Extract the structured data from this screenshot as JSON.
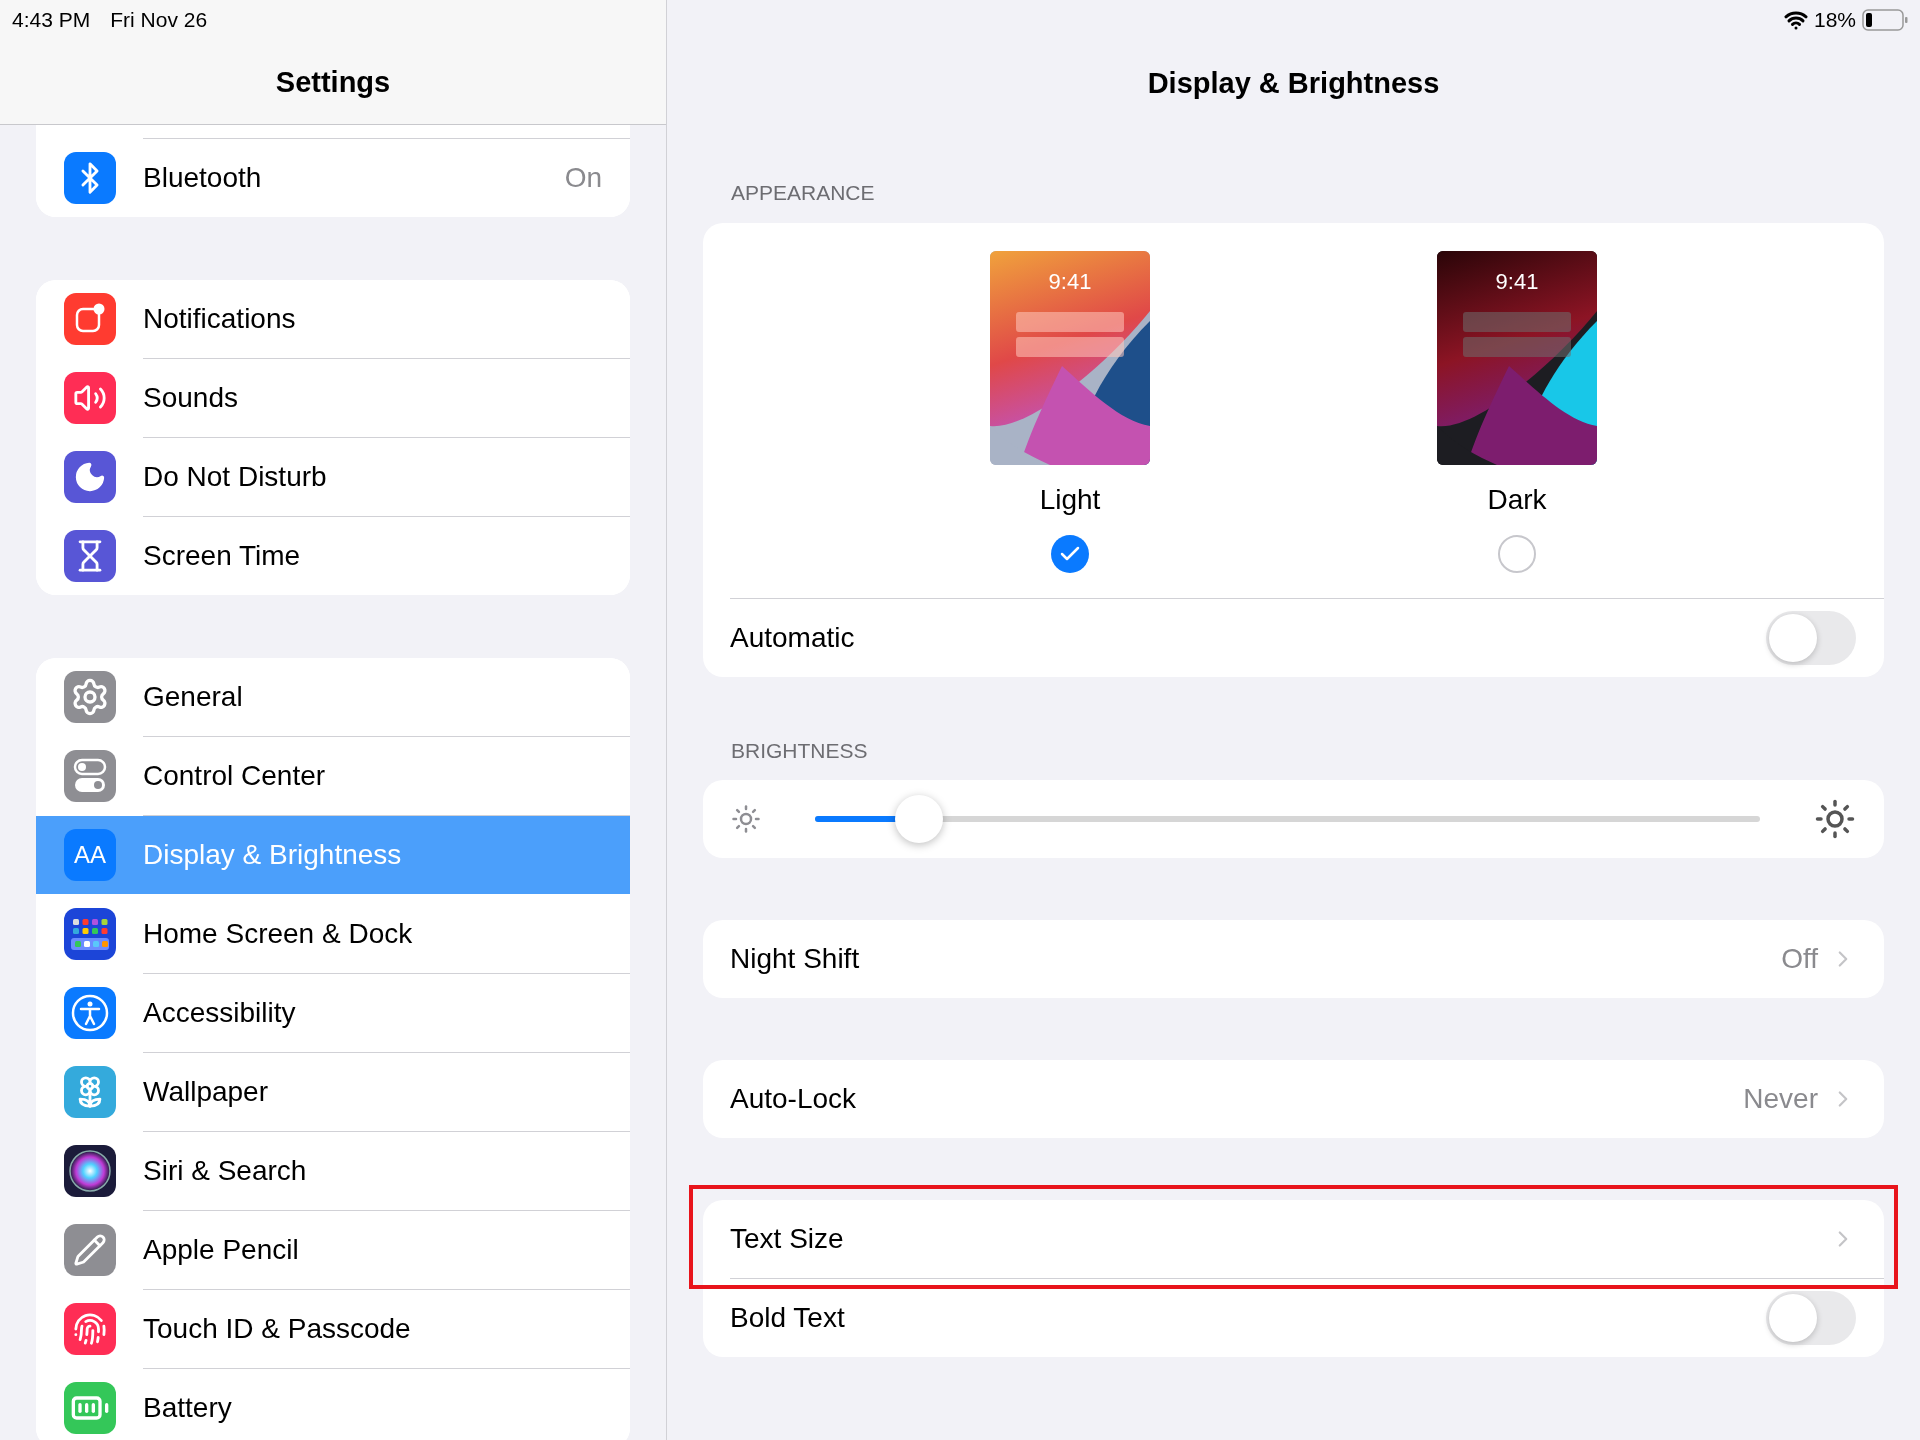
{
  "status_bar": {
    "time": "4:43 PM",
    "date": "Fri Nov 26",
    "battery": "18%"
  },
  "sidebar": {
    "title": "Settings",
    "groups": [
      {
        "items": [
          {
            "label": "Bluetooth",
            "value": "On",
            "selected": false
          }
        ]
      },
      {
        "items": [
          {
            "label": "Notifications",
            "selected": false
          },
          {
            "label": "Sounds",
            "selected": false
          },
          {
            "label": "Do Not Disturb",
            "selected": false
          },
          {
            "label": "Screen Time",
            "selected": false
          }
        ]
      },
      {
        "items": [
          {
            "label": "General",
            "selected": false
          },
          {
            "label": "Control Center",
            "selected": false
          },
          {
            "label": "Display & Brightness",
            "icon_text": "AA",
            "selected": true
          },
          {
            "label": "Home Screen & Dock",
            "selected": false
          },
          {
            "label": "Accessibility",
            "selected": false
          },
          {
            "label": "Wallpaper",
            "selected": false
          },
          {
            "label": "Siri & Search",
            "selected": false
          },
          {
            "label": "Apple Pencil",
            "selected": false
          },
          {
            "label": "Touch ID & Passcode",
            "selected": false
          },
          {
            "label": "Battery",
            "selected": false
          }
        ]
      }
    ]
  },
  "detail": {
    "title": "Display & Brightness",
    "sections": [
      {
        "kind": "appearance",
        "header": "APPEARANCE",
        "options": [
          {
            "label": "Light",
            "time": "9:41",
            "selected": true
          },
          {
            "label": "Dark",
            "time": "9:41",
            "selected": false
          }
        ],
        "rows": [
          {
            "kind": "toggle",
            "label": "Automatic",
            "on": false
          }
        ]
      },
      {
        "kind": "brightness",
        "header": "BRIGHTNESS",
        "level": 0.11
      },
      {
        "kind": "list",
        "rows": [
          {
            "kind": "disclosure",
            "label": "Night Shift",
            "value": "Off",
            "highlighted": false
          }
        ]
      },
      {
        "kind": "list",
        "rows": [
          {
            "kind": "disclosure",
            "label": "Auto-Lock",
            "value": "Never",
            "highlighted": false
          }
        ]
      },
      {
        "kind": "list",
        "rows": [
          {
            "kind": "disclosure",
            "label": "Text Size",
            "highlighted": true
          },
          {
            "kind": "toggle",
            "label": "Bold Text",
            "on": false,
            "highlighted": false
          }
        ]
      }
    ]
  }
}
